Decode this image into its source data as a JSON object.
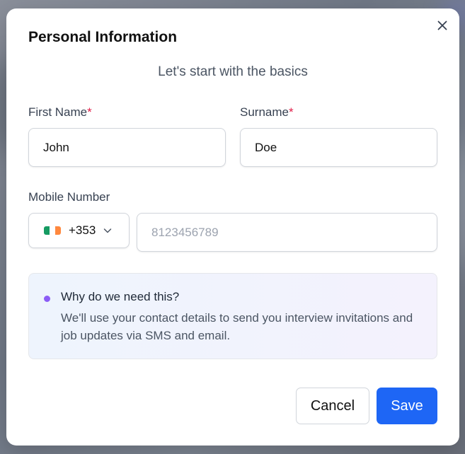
{
  "modal": {
    "title": "Personal Information",
    "subtitle": "Let's start with the basics",
    "close_icon": "close-icon"
  },
  "form": {
    "first_name": {
      "label": "First Name",
      "required_marker": "*",
      "value": "John"
    },
    "surname": {
      "label": "Surname",
      "required_marker": "*",
      "value": "Doe"
    },
    "mobile": {
      "label": "Mobile Number",
      "country_code": "+353",
      "country_flag": "ireland-flag-icon",
      "placeholder": "8123456789",
      "value": ""
    }
  },
  "info": {
    "title": "Why do we need this?",
    "body": "We'll use your contact details to send you interview invitations and job updates via SMS and email."
  },
  "actions": {
    "cancel_label": "Cancel",
    "save_label": "Save"
  },
  "colors": {
    "primary": "#1e66f5",
    "required": "#e11d48",
    "info_dot": "#8b5cf6",
    "flag_green": "#169b62",
    "flag_white": "#ffffff",
    "flag_orange": "#ff883e"
  }
}
